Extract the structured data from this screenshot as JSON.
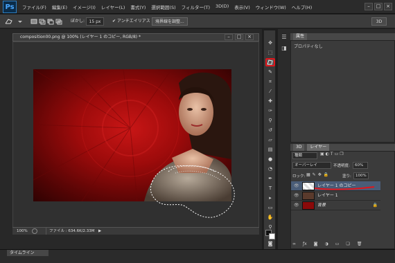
{
  "app": {
    "logo": "Ps"
  },
  "menu": [
    "ファイル(F)",
    "編集(E)",
    "イメージ(I)",
    "レイヤー(L)",
    "書式(Y)",
    "選択範囲(S)",
    "フィルター(T)",
    "3D(D)",
    "表示(V)",
    "ウィンドウ(W)",
    "ヘルプ(H)"
  ],
  "window_controls": [
    "–",
    "□",
    "×"
  ],
  "options": {
    "feather_label": "ぼかし:",
    "feather_value": "15 px",
    "antialias_label": "アンチエイリアス",
    "refine_button": "境界線を調整...",
    "workspace": "3D"
  },
  "document": {
    "tab_title": "composition00.png @ 100% (レイヤー 1 のコピー, RGB/8) *",
    "zoom": "100%",
    "file_info": "ファイル : 634.6K/2.33M"
  },
  "properties": {
    "title": "属性",
    "content": "プロパティなし"
  },
  "layers_panel": {
    "tabs": [
      "3D",
      "レイヤー"
    ],
    "kind": "種類",
    "blend_mode": "オーバーレイ",
    "opacity_label": "不透明度:",
    "opacity_value": "60%",
    "lock_label": "ロック:",
    "fill_label": "塗り:",
    "fill_value": "100%",
    "layers": [
      {
        "name": "レイヤー 1 のコピー"
      },
      {
        "name": "レイヤー 1"
      },
      {
        "name": "背景"
      }
    ]
  },
  "timeline": {
    "tab": "タイムライン"
  },
  "colors": {
    "accent_red": "#e0151b",
    "canvas_red": "#b01010"
  }
}
